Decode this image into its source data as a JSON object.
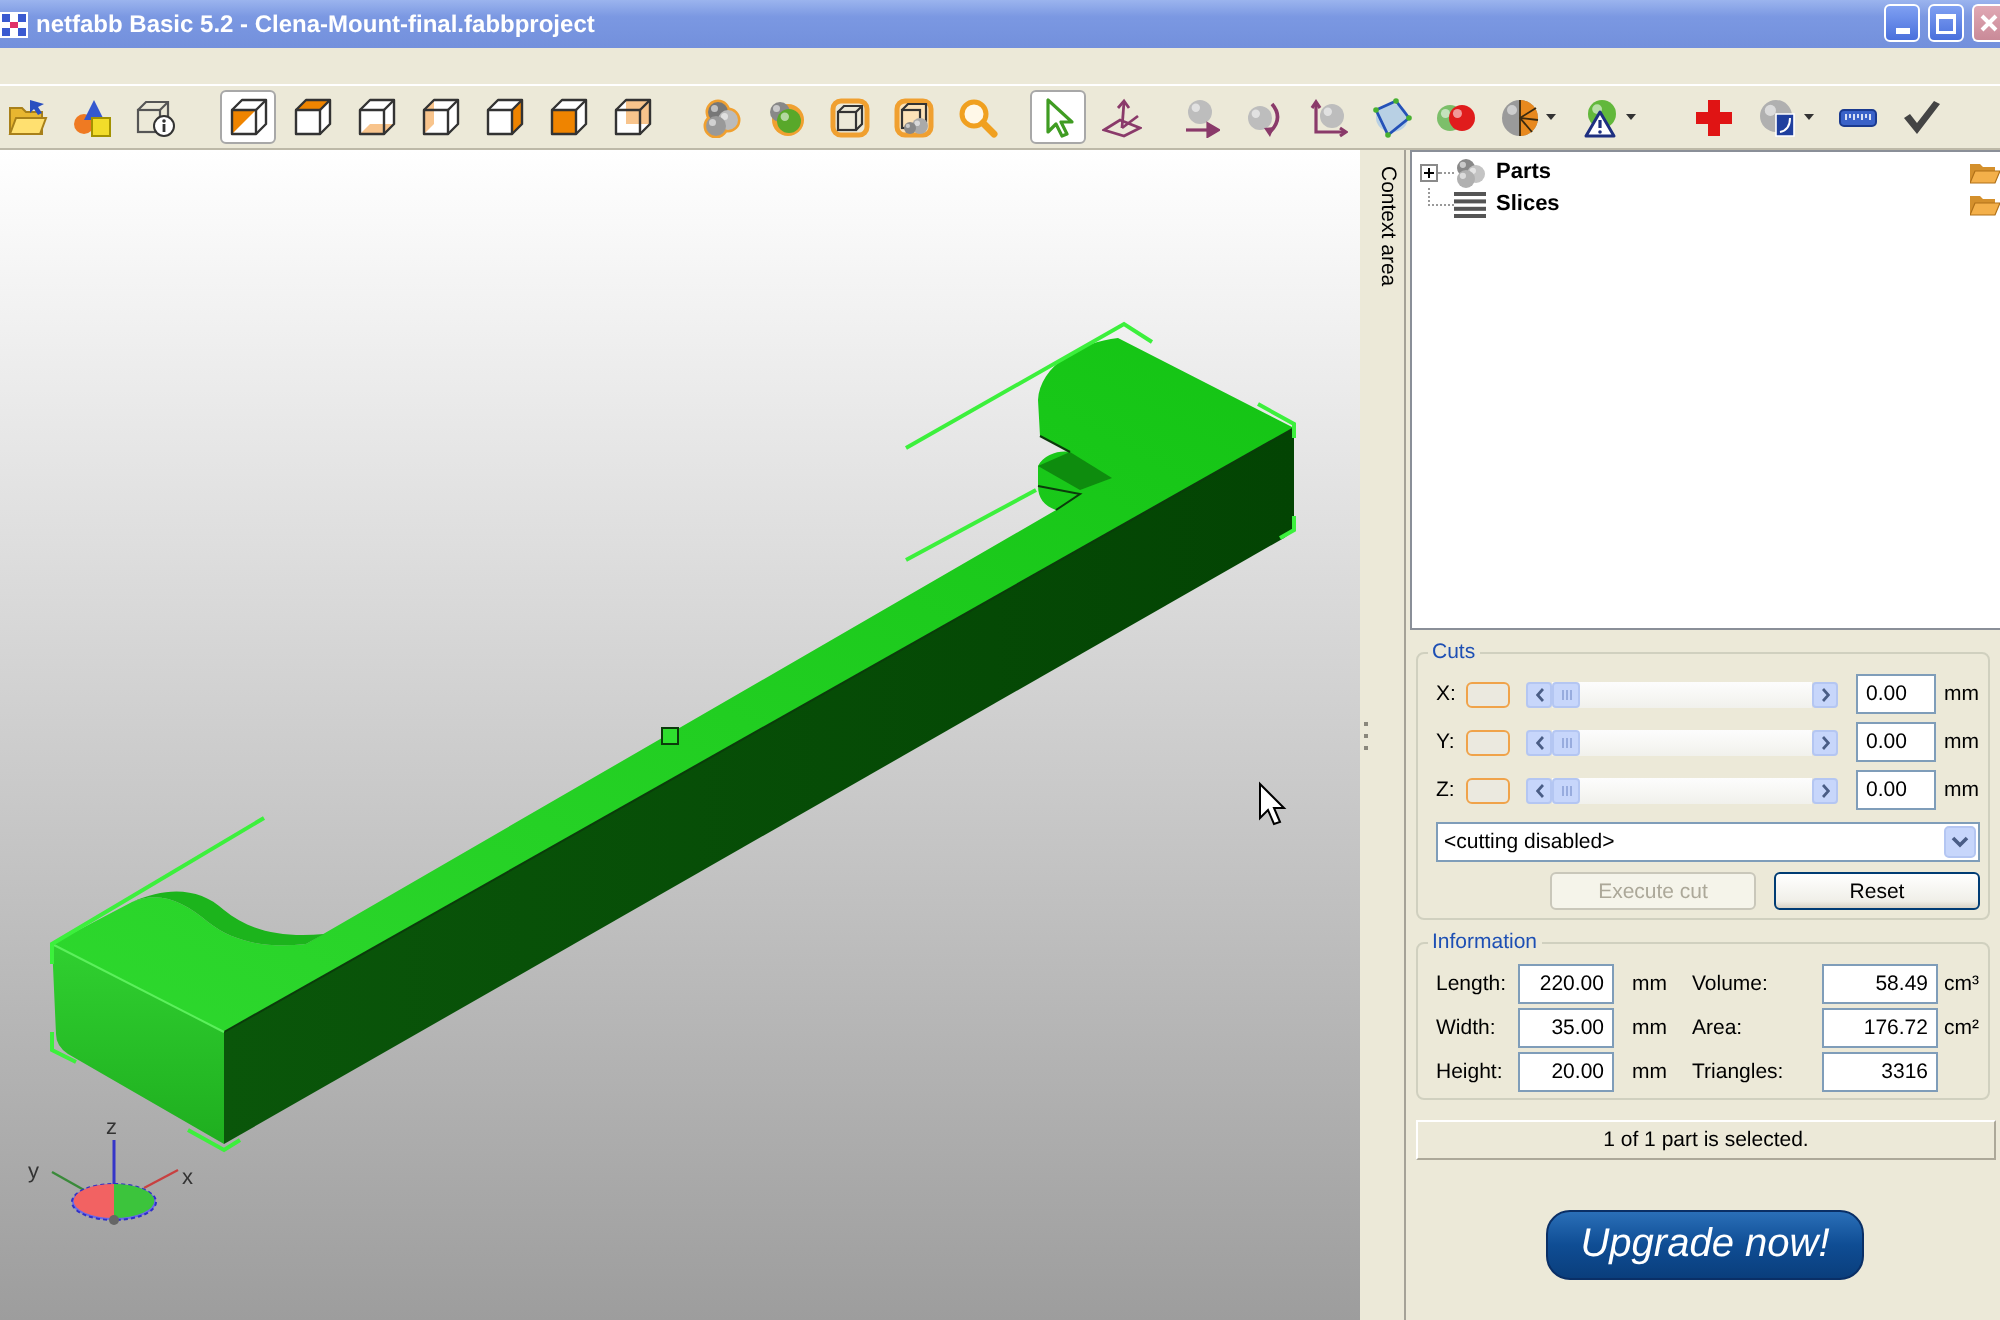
{
  "window": {
    "title": "netfabb Basic 5.2 - Clena-Mount-final.fabbproject"
  },
  "toolbar": {
    "groups": [
      {
        "tools": [
          {
            "kind": "open",
            "selected": false,
            "dropdown": false
          },
          {
            "kind": "primitives",
            "selected": false,
            "dropdown": false
          },
          {
            "kind": "part-info",
            "selected": false,
            "dropdown": false
          }
        ]
      },
      {
        "tools": [
          {
            "kind": "view-iso",
            "selected": true,
            "dropdown": false
          },
          {
            "kind": "view-top",
            "selected": false,
            "dropdown": false
          },
          {
            "kind": "view-bottom",
            "selected": false,
            "dropdown": false
          },
          {
            "kind": "view-left",
            "selected": false,
            "dropdown": false
          },
          {
            "kind": "view-right",
            "selected": false,
            "dropdown": false
          },
          {
            "kind": "view-front",
            "selected": false,
            "dropdown": false
          },
          {
            "kind": "view-back",
            "selected": false,
            "dropdown": false
          }
        ]
      },
      {
        "tools": [
          {
            "kind": "spheres",
            "selected": false,
            "dropdown": false
          },
          {
            "kind": "sphere-solid",
            "selected": false,
            "dropdown": false
          },
          {
            "kind": "cube-halo",
            "selected": false,
            "dropdown": false
          },
          {
            "kind": "cube-spheres",
            "selected": false,
            "dropdown": false
          },
          {
            "kind": "zoom",
            "selected": false,
            "dropdown": false
          }
        ]
      },
      {
        "tools": [
          {
            "kind": "select",
            "selected": true,
            "dropdown": false
          },
          {
            "kind": "plane-axes",
            "selected": false,
            "dropdown": false
          }
        ]
      },
      {
        "tools": [
          {
            "kind": "move",
            "selected": false,
            "dropdown": false
          },
          {
            "kind": "rotate",
            "selected": false,
            "dropdown": false
          },
          {
            "kind": "scale",
            "selected": false,
            "dropdown": false
          },
          {
            "kind": "frame",
            "selected": false,
            "dropdown": false
          },
          {
            "kind": "boolean",
            "selected": false,
            "dropdown": false
          },
          {
            "kind": "mesh",
            "selected": false,
            "dropdown": true
          },
          {
            "kind": "repair",
            "selected": false,
            "dropdown": true
          }
        ]
      },
      {
        "tools": [
          {
            "kind": "add",
            "selected": false,
            "dropdown": false
          },
          {
            "kind": "report",
            "selected": false,
            "dropdown": true
          },
          {
            "kind": "measure",
            "selected": false,
            "dropdown": false
          },
          {
            "kind": "check",
            "selected": false,
            "dropdown": false
          }
        ]
      }
    ]
  },
  "viewport": {
    "part": {
      "selected": true
    },
    "axis_labels": [
      {
        "kind": "z",
        "label": "z"
      },
      {
        "kind": "y",
        "label": "y"
      },
      {
        "kind": "x",
        "label": "x"
      }
    ]
  },
  "context_tab": {
    "label": "Context area"
  },
  "tree": {
    "items": [
      {
        "kind": "parts",
        "label": "Parts",
        "expanded": false
      },
      {
        "kind": "slices",
        "label": "Slices"
      }
    ]
  },
  "cuts": {
    "title": "Cuts",
    "axes": [
      {
        "label": "X:",
        "checked": false,
        "level": 0,
        "value": "0.00",
        "unit": "mm"
      },
      {
        "label": "Y:",
        "checked": false,
        "level": 0,
        "value": "0.00",
        "unit": "mm"
      },
      {
        "label": "Z:",
        "checked": false,
        "level": 0,
        "value": "0.00",
        "unit": "mm"
      }
    ],
    "mode": {
      "value": "<cutting disabled>"
    },
    "buttons": [
      {
        "label": "Execute cut",
        "disabled": true
      },
      {
        "label": "Reset",
        "disabled": false
      }
    ]
  },
  "information": {
    "title": "Information",
    "fields": [
      {
        "label": "Length:",
        "value": "220.00",
        "unit": "mm"
      },
      {
        "label": "Volume:",
        "value": "58.49",
        "unit": "cm³"
      },
      {
        "label": "Width:",
        "value": "35.00",
        "unit": "mm"
      },
      {
        "label": "Area:",
        "value": "176.72",
        "unit": "cm²"
      },
      {
        "label": "Height:",
        "value": "20.00",
        "unit": "mm"
      },
      {
        "label": "Triangles:",
        "value": "3316"
      }
    ]
  },
  "status": {
    "text": "1 of 1 part is selected."
  },
  "upgrade_button": {
    "label": "Upgrade now!"
  }
}
